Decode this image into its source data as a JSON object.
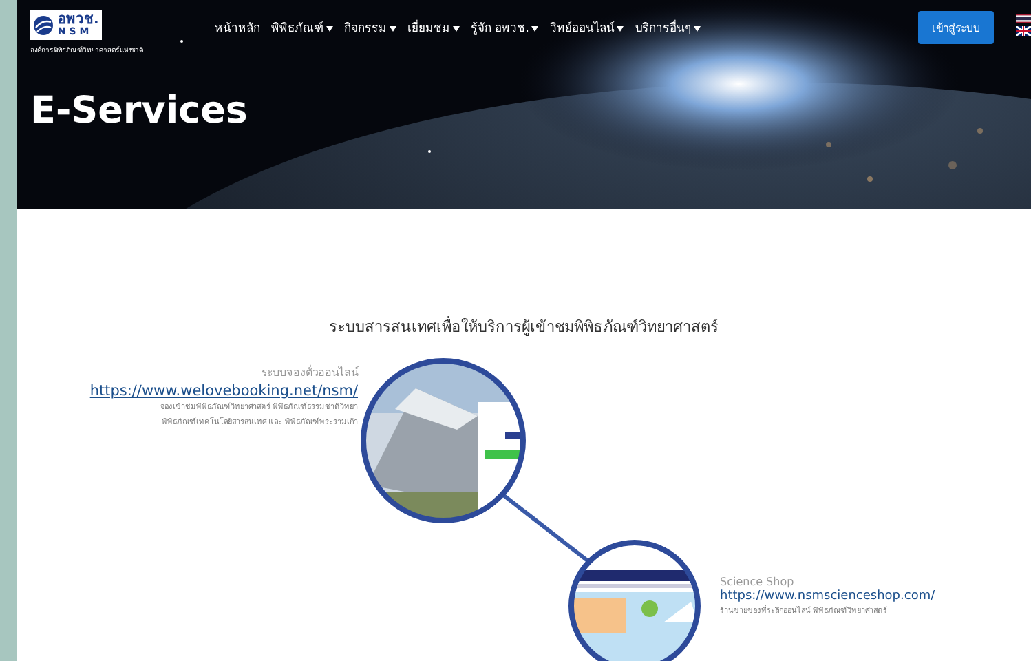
{
  "header": {
    "logo": {
      "name": "อพวช.",
      "abbr": "N S M",
      "tagline": "องค์การพิพิธภัณฑ์วิทยาศาสตร์แห่งชาติ"
    },
    "menu": [
      {
        "label": "หน้าหลัก",
        "dropdown": false
      },
      {
        "label": "พิพิธภัณฑ์",
        "dropdown": true
      },
      {
        "label": "กิจกรรม",
        "dropdown": true
      },
      {
        "label": "เยี่ยมชม",
        "dropdown": true
      },
      {
        "label": "รู้จัก อพวช.",
        "dropdown": true
      },
      {
        "label": "วิทย์ออนไลน์",
        "dropdown": true
      },
      {
        "label": "บริการอื่นๆ",
        "dropdown": true
      }
    ],
    "login_button": "เข้าสู่ระบบ"
  },
  "hero": {
    "title": "E-Services"
  },
  "section": {
    "heading": "ระบบสารสนเทศเพื่อให้บริการผู้เข้าชมพิพิธภัณฑ์วิทยาศาสตร์",
    "services": [
      {
        "name": "ระบบจองตั๋วออนไลน์",
        "url": "https://www.welovebooking.net/nsm/",
        "description": [
          "จองเข้าชมพิพิธภัณฑ์วิทยาศาสตร์ พิพิธภัณฑ์ธรรมชาติวิทยา",
          "พิพิธภัณฑ์เทคโนโลยีสารสนเทศ และ พิพิธภัณฑ์พระรามเก้า"
        ]
      },
      {
        "name": "Science Shop",
        "url": "https://www.nsmscienceshop.com/",
        "description": [
          "ร้านขายของที่ระลึกออนไลน์ พิพิธภัณฑ์วิทยาศาสตร์"
        ]
      }
    ]
  }
}
